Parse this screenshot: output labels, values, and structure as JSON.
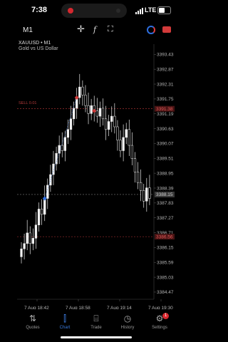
{
  "status_bar": {
    "time": "7:38",
    "network": "LTE",
    "battery_fraction": 0.55
  },
  "toolbar": {
    "timeframe": "M1"
  },
  "chart": {
    "symbol_line": "XAUUSD • M1",
    "description": "Gold vs US Dollar",
    "sell_label": "SELL 0.01",
    "price_ticks": [
      "3393.43",
      "3392.87",
      "3392.31",
      "3391.75",
      "3391.19",
      "3390.63",
      "3390.07",
      "3389.51",
      "3388.95",
      "3388.39",
      "3387.83",
      "3387.27",
      "3386.71",
      "3386.15",
      "3385.59",
      "3385.03",
      "3384.47"
    ],
    "marked_prices": [
      {
        "value": "3391.38",
        "color": "#c0393b"
      },
      {
        "value": "3388.15",
        "color": "#7a7a7a"
      },
      {
        "value": "3386.56",
        "color": "#c0393b"
      }
    ],
    "time_labels": [
      "7 Aug 18:42",
      "7 Aug 18:58",
      "7 Aug 19:14",
      "7 Aug 19:30"
    ]
  },
  "chart_data": {
    "type": "candlestick",
    "instrument": "XAUUSD",
    "timeframe": "M1",
    "ylim": [
      3384.2,
      3393.6
    ],
    "close_series": [
      3386.1,
      3386.3,
      3386.7,
      3386.3,
      3386.5,
      3387.0,
      3387.6,
      3387.4,
      3388.0,
      3388.5,
      3388.9,
      3389.3,
      3389.7,
      3390.0,
      3389.8,
      3390.3,
      3390.6,
      3391.0,
      3391.4,
      3391.8,
      3392.2,
      3391.9,
      3391.5,
      3391.2,
      3391.5,
      3391.3,
      3391.1,
      3391.4,
      3391.0,
      3390.6,
      3390.9,
      3391.1,
      3390.7,
      3390.2,
      3389.8,
      3390.3,
      3390.6,
      3390.0,
      3389.5,
      3389.0,
      3388.6,
      3388.3,
      3387.9,
      3388.4,
      3388.0
    ],
    "x_range": [
      "7 Aug 18:42",
      "7 Aug 19:30"
    ]
  },
  "nav": {
    "items": [
      {
        "label": "Quotes",
        "icon": "⇅"
      },
      {
        "label": "Chart",
        "icon": "⫿"
      },
      {
        "label": "Trade",
        "icon": "⌸"
      },
      {
        "label": "History",
        "icon": "◷"
      },
      {
        "label": "Settings",
        "icon": "⚙"
      }
    ],
    "settings_badge": "1"
  }
}
